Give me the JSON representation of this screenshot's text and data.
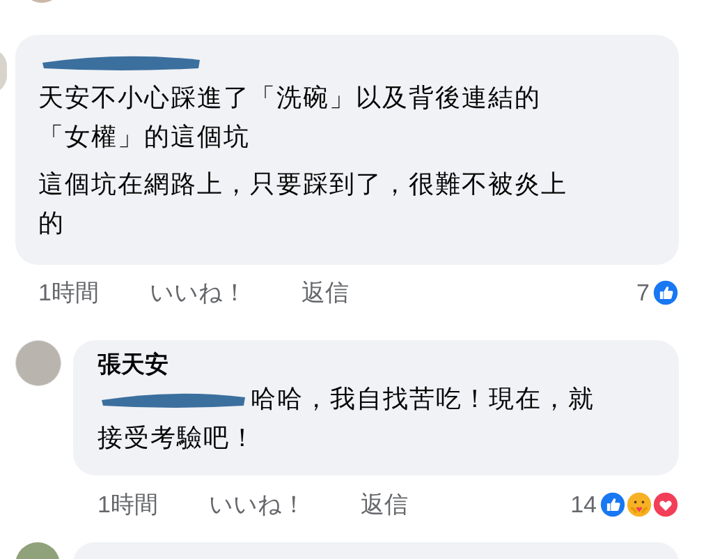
{
  "comments": [
    {
      "kind": "top",
      "name_redacted": true,
      "paragraphs": [
        [
          "天安不小心踩進了「洗碗」以及背後連結的",
          "「女權」的這個坑"
        ],
        [
          "這個坑在網路上，只要踩到了，很難不被炎上",
          "的"
        ]
      ],
      "time": "1時間",
      "like": "いいね！",
      "reply": "返信",
      "reaction_count": "7",
      "reactions": [
        {
          "kind": "like"
        }
      ]
    },
    {
      "kind": "reply",
      "name": "張天安",
      "mention_redacted": true,
      "paragraphs": [
        [
          "哈哈，我自找苦吃！現在，就",
          "接受考驗吧！"
        ]
      ],
      "time": "1時間",
      "like": "いいね！",
      "reply": "返信",
      "reaction_count": "14",
      "reactions": [
        {
          "kind": "like"
        },
        {
          "kind": "care"
        },
        {
          "kind": "love"
        }
      ]
    }
  ]
}
